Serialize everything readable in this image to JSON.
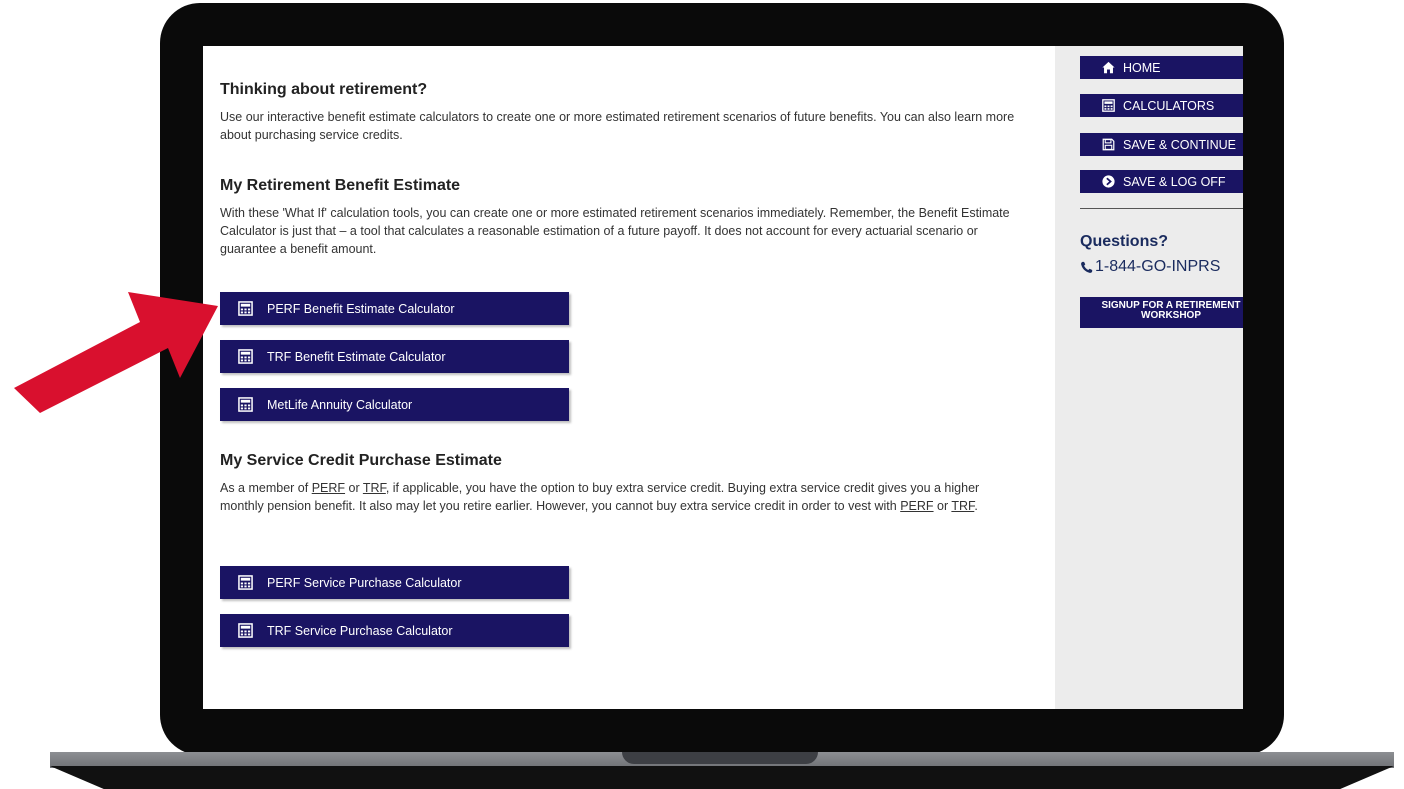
{
  "main": {
    "retirement": {
      "heading": "Thinking about retirement?",
      "text": "Use our interactive benefit estimate calculators to create one or more estimated retirement scenarios of future benefits. You can also learn more about purchasing service credits."
    },
    "benefit_estimate": {
      "heading": "My Retirement Benefit Estimate",
      "text": "With these 'What If' calculation tools, you can create one or more estimated retirement scenarios immediately. Remember, the Benefit Estimate Calculator is just that – a tool that calculates a reasonable estimation of a future payoff. It does not account for every actuarial scenario or guarantee a benefit amount.",
      "buttons": [
        "PERF Benefit Estimate Calculator",
        "TRF Benefit Estimate Calculator",
        "MetLife Annuity Calculator"
      ]
    },
    "service_credit": {
      "heading": "My Service Credit Purchase Estimate",
      "text_1": "As a member of ",
      "link_perf_1": "PERF",
      "text_2": " or ",
      "link_trf_1": "TRF",
      "text_3": ", if applicable, you have the option to buy extra service credit. Buying extra service credit gives you a higher monthly pension benefit. It also may let you retire earlier. However, you cannot buy extra service credit in order to vest with ",
      "link_perf_2": "PERF",
      "text_4": " or ",
      "link_trf_2": "TRF",
      "text_5": ".",
      "buttons": [
        "PERF Service Purchase Calculator",
        "TRF Service Purchase Calculator"
      ]
    }
  },
  "sidebar": {
    "nav": [
      {
        "label": "HOME",
        "icon": "home-icon"
      },
      {
        "label": "CALCULATORS",
        "icon": "calculator-icon"
      },
      {
        "label": "SAVE & CONTINUE",
        "icon": "save-icon"
      },
      {
        "label": "SAVE & LOG OFF",
        "icon": "arrow-circle-icon"
      }
    ],
    "questions_label": "Questions?",
    "phone": "1-844-GO-INPRS",
    "signup_line1": "SIGNUP FOR A RETIREMENT",
    "signup_line2": "WORKSHOP"
  },
  "colors": {
    "button_bg": "#1a1463",
    "sidebar_bg": "#ececec",
    "arrow": "#d9102e",
    "heading_blue": "#1a2b5e"
  }
}
